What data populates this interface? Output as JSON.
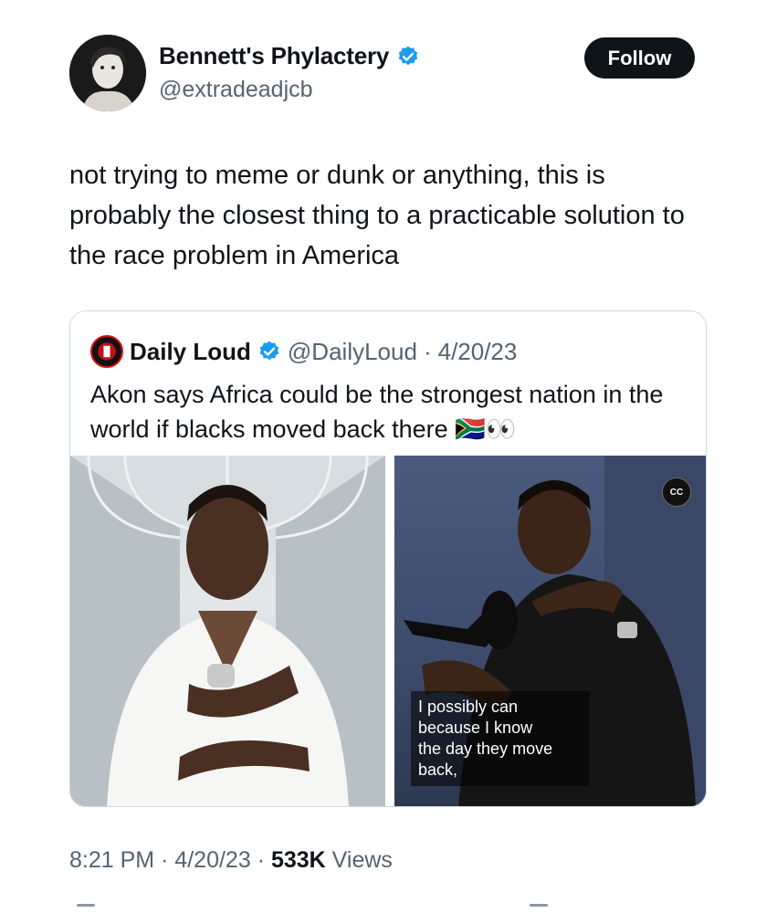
{
  "author": {
    "name": "Bennett's Phylactery",
    "handle": "@extradeadjcb",
    "verified": true,
    "avatar_icon": "portrait-avatar-icon"
  },
  "follow_label": "Follow",
  "tweet_text": "not trying to meme or dunk or anything, this is probably the closest thing to a practicable solution to the race problem in America",
  "quote": {
    "name": "Daily Loud",
    "handle": "@DailyLoud",
    "separator": "·",
    "date": "4/20/23",
    "text": "Akon says Africa could be the strongest nation in the world if blacks moved back there 🇿🇦👀",
    "media": {
      "cc_label": "CC",
      "caption": "I possibly can\nbecause I know\nthe day they move\nback,"
    }
  },
  "meta": {
    "time": "8:21 PM",
    "sep1": " · ",
    "date": "4/20/23",
    "sep2": " · ",
    "views_count": "533K",
    "views_label": " Views"
  },
  "colors": {
    "text": "#0f1419",
    "secondary": "#536471",
    "verified_blue": "#1d9bf0",
    "border": "#cfd9de"
  }
}
